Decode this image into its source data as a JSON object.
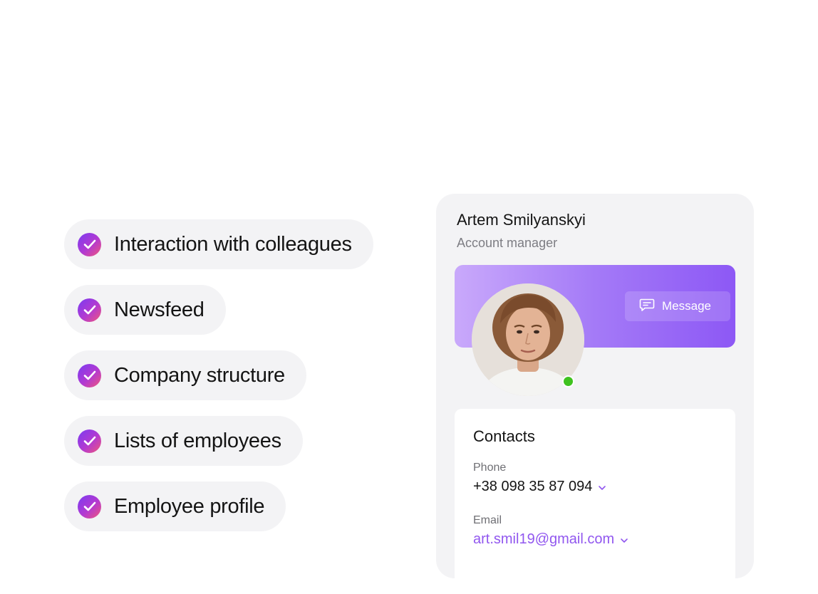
{
  "features": [
    {
      "label": "Interaction with colleagues",
      "icon": "check-circle-icon"
    },
    {
      "label": "Newsfeed",
      "icon": "check-circle-icon"
    },
    {
      "label": "Company structure",
      "icon": "check-circle-icon"
    },
    {
      "label": "Lists of employees",
      "icon": "check-circle-icon"
    },
    {
      "label": "Employee profile",
      "icon": "check-circle-icon"
    }
  ],
  "profile": {
    "name": "Artem Smilyanskyi",
    "role": "Account manager",
    "message_button": "Message",
    "status": "online",
    "status_color": "#3fc21f"
  },
  "contacts": {
    "title": "Contacts",
    "phone_label": "Phone",
    "phone_value": "+38 098 35 87 094",
    "email_label": "Email",
    "email_value": "art.smil19@gmail.com"
  },
  "colors": {
    "accent": "#8d58f5",
    "email_text": "#9157ef",
    "pill_bg": "#f3f3f5"
  }
}
